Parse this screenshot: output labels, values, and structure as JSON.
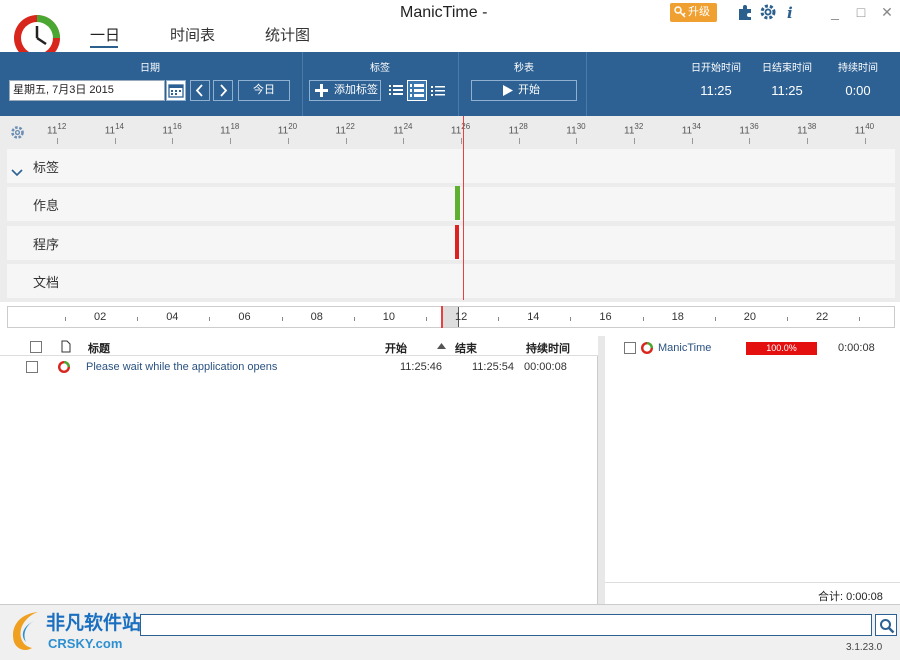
{
  "app": {
    "title": "ManicTime -"
  },
  "tabs": [
    {
      "label": "一日",
      "active": true
    },
    {
      "label": "时间表",
      "active": false
    },
    {
      "label": "统计图",
      "active": false
    }
  ],
  "titlebar": {
    "upgrade_label": "升级"
  },
  "toolbar": {
    "date_section_title": "日期",
    "date_value": "星期五, 7月3日 2015",
    "today_label": "今日",
    "tags_section_title": "标签",
    "add_tag_label": "添加标签",
    "stopwatch_section_title": "秒表",
    "start_label": "开始",
    "stats": [
      {
        "label": "日开始时间",
        "value": "11:25"
      },
      {
        "label": "日结束时间",
        "value": "11:25"
      },
      {
        "label": "持续时间",
        "value": "0:00"
      }
    ]
  },
  "timeline": {
    "ticks": [
      {
        "hour": "11",
        "min": "12"
      },
      {
        "hour": "11",
        "min": "14"
      },
      {
        "hour": "11",
        "min": "16"
      },
      {
        "hour": "11",
        "min": "18"
      },
      {
        "hour": "11",
        "min": "20"
      },
      {
        "hour": "11",
        "min": "22"
      },
      {
        "hour": "11",
        "min": "24"
      },
      {
        "hour": "11",
        "min": "26"
      },
      {
        "hour": "11",
        "min": "28"
      },
      {
        "hour": "11",
        "min": "30"
      },
      {
        "hour": "11",
        "min": "32"
      },
      {
        "hour": "11",
        "min": "34"
      },
      {
        "hour": "11",
        "min": "36"
      },
      {
        "hour": "11",
        "min": "38"
      },
      {
        "hour": "11",
        "min": "40"
      }
    ],
    "lanes": [
      "标签",
      "作息",
      "程序",
      "文档"
    ]
  },
  "overview": {
    "labels": [
      "02",
      "04",
      "06",
      "08",
      "10",
      "12",
      "14",
      "16",
      "18",
      "20",
      "22"
    ]
  },
  "list": {
    "headers": {
      "title": "标题",
      "start": "开始",
      "end": "结束",
      "duration": "持续时间"
    },
    "rows": [
      {
        "title": "Please wait while the application opens",
        "start": "11:25:46",
        "end": "11:25:54",
        "duration": "00:00:08"
      }
    ]
  },
  "apps": {
    "rows": [
      {
        "name": "ManicTime",
        "percent": "100.0%",
        "duration": "0:00:08"
      }
    ],
    "total_label": "合计: 0:00:08"
  },
  "watermark": {
    "line1": "非凡软件站",
    "line2": "CRSKY.com"
  },
  "status": {
    "version": "3.1.23.0"
  },
  "colors": {
    "accent": "#2d6193",
    "now_line": "#e64040",
    "active_bar": "#5db12f",
    "app_bar": "#dd2222",
    "percent_bar": "#e41010"
  }
}
